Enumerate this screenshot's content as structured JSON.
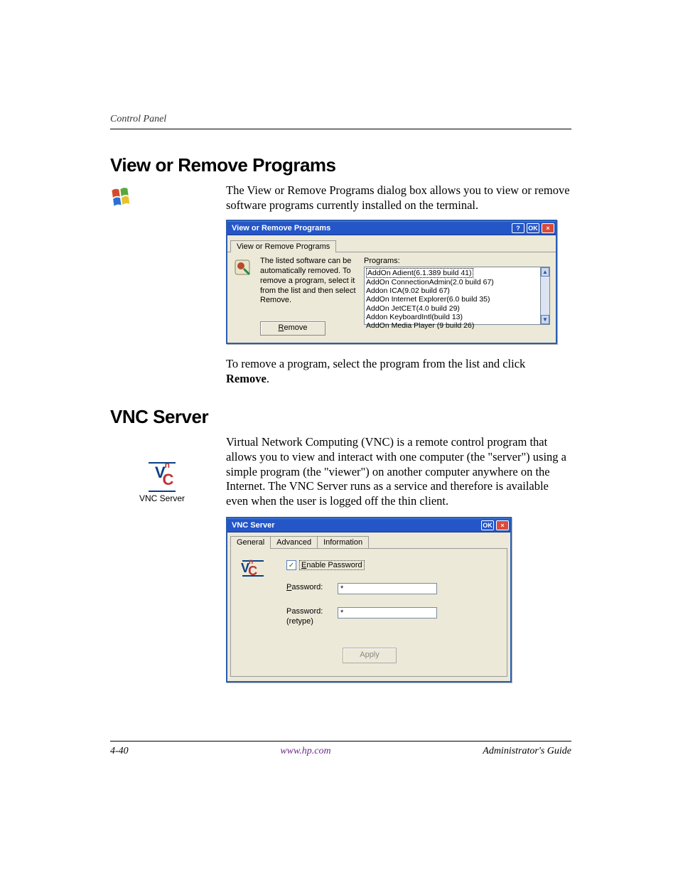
{
  "running_head": "Control Panel",
  "section1": {
    "title": "View or Remove Programs",
    "para1": "The View or Remove Programs dialog box allows you to view or remove software programs currently installed on the terminal.",
    "para2_a": "To remove a program, select the program from the list and click ",
    "para2_b": "Remove",
    "para2_c": "."
  },
  "dialog1": {
    "title": "View or Remove Programs",
    "tab": "View or Remove Programs",
    "help_btn": "?",
    "ok_btn": "OK",
    "close_btn": "×",
    "desc": "The listed software can be automatically removed. To remove a program, select it from the list and then select Remove.",
    "remove_label_u": "R",
    "remove_label_rest": "emove",
    "programs_label": "Programs:",
    "programs": [
      "AddOn Adient(6.1.389 build 41)",
      "AddOn ConnectionAdmin(2.0 build 67)",
      "Addon ICA(9.02 build 67)",
      "AddOn Internet Explorer(6.0 build 35)",
      "AddOn JetCET(4.0 build 29)",
      "Addon KeyboardIntl(build 13)",
      "AddOn Media Player (9 build 26)"
    ],
    "scroll_up": "▲",
    "scroll_down": "▼"
  },
  "section2": {
    "title": "VNC Server",
    "para1": "Virtual Network Computing (VNC) is a remote control program that allows you to view and interact with one computer (the \"server\") using a simple program (the \"viewer\") on another computer anywhere on the Internet. The VNC Server runs as a service and therefore is available even when the user is logged off the thin client."
  },
  "vnc_margin": {
    "logo_v": "V",
    "logo_c": "C",
    "caption": "VNC Server"
  },
  "dialog2": {
    "title": "VNC Server",
    "ok_btn": "OK",
    "close_btn": "×",
    "tabs": {
      "general": "General",
      "advanced": "Advanced",
      "information": "Information"
    },
    "enable_u": "E",
    "enable_rest": "nable Password",
    "checked": "✓",
    "pwd_label_u": "P",
    "pwd_label_rest": "assword:",
    "pwd_retype_label": "Password:\n(retype)",
    "pwd_value": "*",
    "apply": "Apply"
  },
  "footer": {
    "page": "4-40",
    "url": "www.hp.com",
    "guide": "Administrator's Guide"
  }
}
